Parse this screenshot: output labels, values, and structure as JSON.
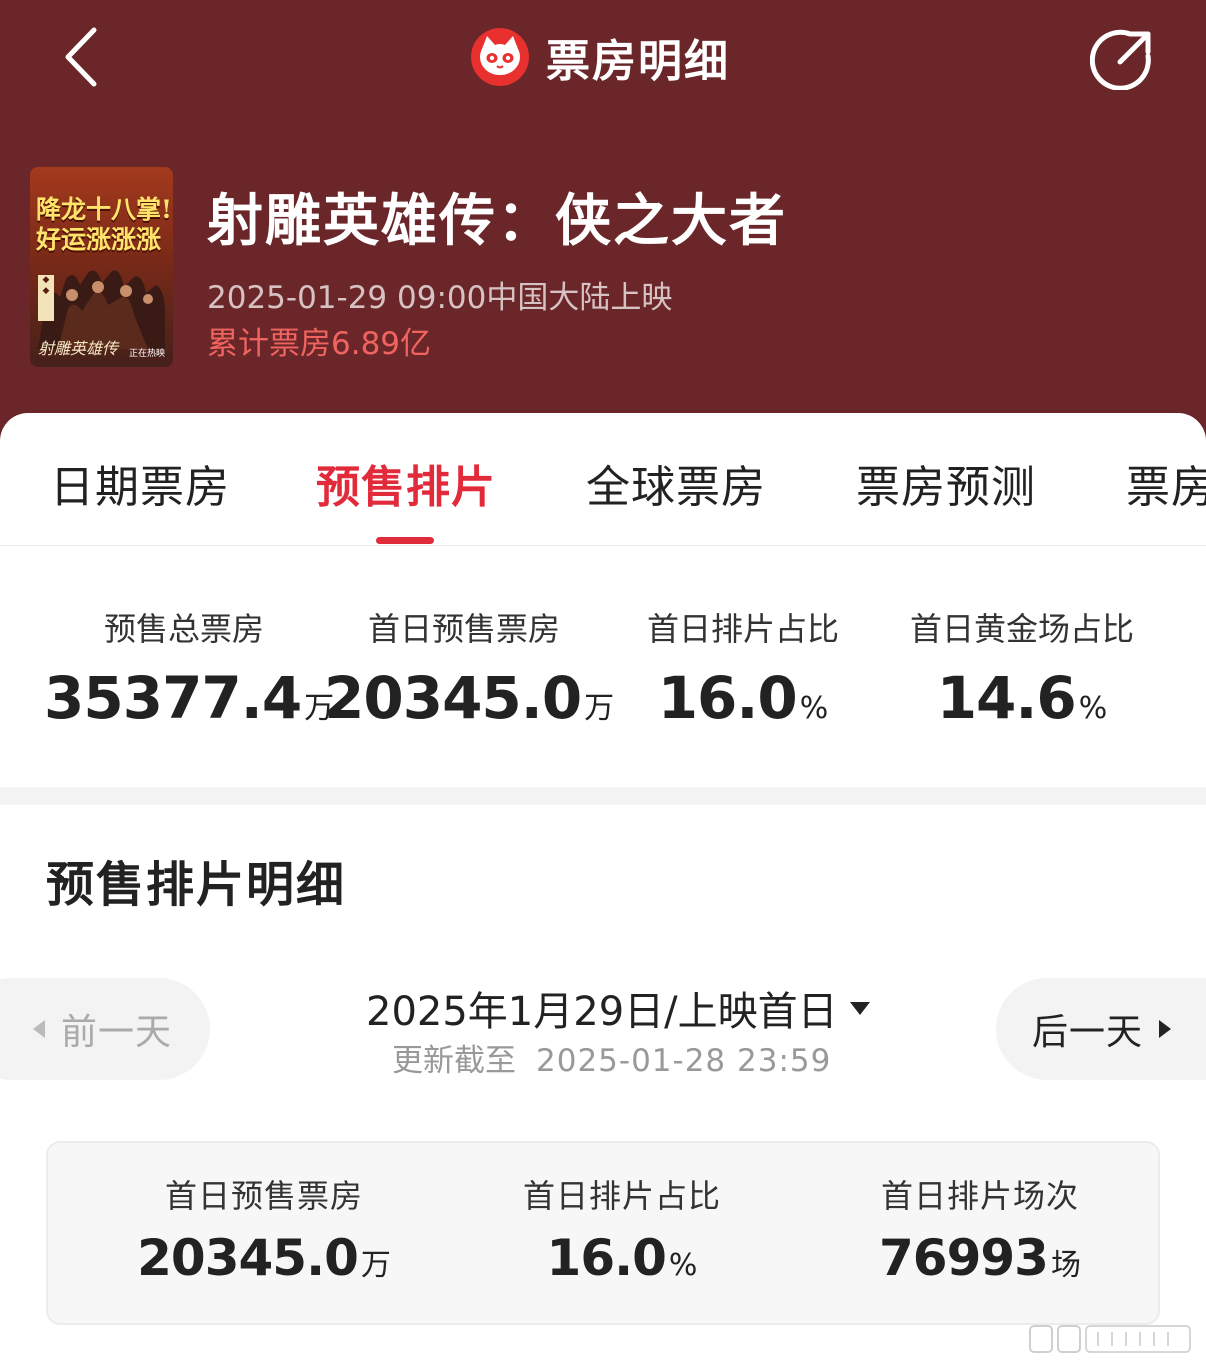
{
  "colors": {
    "header_bg": "#6a2629",
    "accent_red": "#e22b3a",
    "cumulative_red": "#f0645f"
  },
  "nav": {
    "title": "票房明细",
    "logo_icon": "cat-eye-logo-icon",
    "back_icon": "chevron-left-icon",
    "share_icon": "share-icon"
  },
  "movie": {
    "title": "射雕英雄传：侠之大者",
    "release": "2025-01-29 09:00中国大陆上映",
    "cumulative": "累计票房6.89亿",
    "poster": {
      "line1": "降龙十八掌!",
      "line2": "好运涨涨涨",
      "footer": "射雕英雄传",
      "tag": "正在热映"
    }
  },
  "tabs": [
    {
      "label": "日期票房",
      "active": false
    },
    {
      "label": "预售排片",
      "active": true
    },
    {
      "label": "全球票房",
      "active": false
    },
    {
      "label": "票房预测",
      "active": false
    },
    {
      "label": "票房",
      "active": false
    }
  ],
  "stats": [
    {
      "label": "预售总票房",
      "value": "35377.4",
      "unit": "万"
    },
    {
      "label": "首日预售票房",
      "value": "20345.0",
      "unit": "万"
    },
    {
      "label": "首日排片占比",
      "value": "16.0",
      "unit": "%"
    },
    {
      "label": "首日黄金场占比",
      "value": "14.6",
      "unit": "%"
    }
  ],
  "section": {
    "title": "预售排片明细"
  },
  "date_nav": {
    "prev_label": "前一天",
    "next_label": "后一天",
    "current": "2025年1月29日/上映首日",
    "update_prefix": "更新截至",
    "update_time": "2025-01-28  23:59"
  },
  "detail": [
    {
      "label": "首日预售票房",
      "value": "20345.0",
      "unit": "万"
    },
    {
      "label": "首日排片占比",
      "value": "16.0",
      "unit": "%"
    },
    {
      "label": "首日排片场次",
      "value": "76993",
      "unit": "场"
    }
  ]
}
